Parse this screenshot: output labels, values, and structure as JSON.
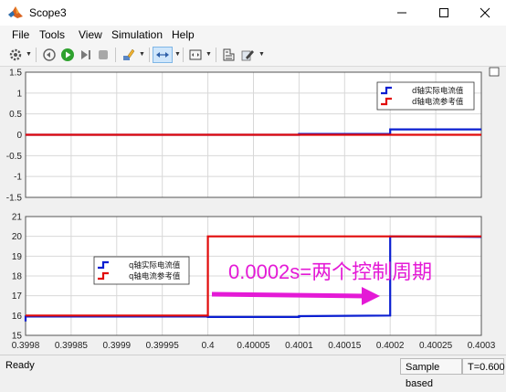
{
  "window": {
    "title": "Scope3"
  },
  "menu": {
    "items": [
      "File",
      "Tools",
      "View",
      "Simulation",
      "Help"
    ]
  },
  "toolbar": {
    "icons": [
      "settings-icon",
      "rewind-icon",
      "run-icon",
      "step-forward-icon",
      "stop-icon",
      "highlight-icon",
      "zoom-icon",
      "fit-axes-icon",
      "cursor-measure-icon",
      "style-icon"
    ]
  },
  "top_plot": {
    "legend": [
      "d轴实际电流值",
      "d轴电流参考值"
    ]
  },
  "bottom_plot": {
    "legend": [
      "q轴实际电流值",
      "q轴电流参考值"
    ],
    "annotation": "0.0002s=两个控制周期"
  },
  "status": {
    "left": "Ready",
    "mode": "Sample based",
    "time": "T=0.600"
  },
  "colors": {
    "actual": "#0b1fd1",
    "reference": "#e10b0b",
    "annotation": "#e41ad6"
  },
  "chart_data": [
    {
      "type": "line",
      "xlim": [
        0.3998,
        0.4003
      ],
      "ylim": [
        -1.5,
        1.5
      ],
      "x_ticks": [
        "0.3998",
        "0.39985",
        "0.3999",
        "0.39995",
        "0.4",
        "0.40005",
        "0.4001",
        "0.40015",
        "0.4002",
        "0.40025",
        "0.4003"
      ],
      "y_ticks": [
        "-1.5",
        "-1",
        "-0.5",
        "0",
        "0.5",
        "1",
        "1.5"
      ],
      "grid": true,
      "legend_position": "top-right",
      "series": [
        {
          "name": "d轴实际电流值",
          "x": [
            0.3998,
            0.4001,
            0.4001,
            0.4002,
            0.4002,
            0.4003
          ],
          "y": [
            0,
            0,
            0.02,
            0.02,
            0.13,
            0.13
          ]
        },
        {
          "name": "d轴电流参考值",
          "x": [
            0.3998,
            0.4003
          ],
          "y": [
            0,
            0
          ]
        }
      ]
    },
    {
      "type": "line",
      "xlim": [
        0.3998,
        0.4003
      ],
      "ylim": [
        15,
        21
      ],
      "x_ticks": [
        "0.3998",
        "0.39985",
        "0.3999",
        "0.39995",
        "0.4",
        "0.40005",
        "0.4001",
        "0.40015",
        "0.4002",
        "0.40025",
        "0.4003"
      ],
      "y_ticks": [
        "15",
        "16",
        "17",
        "18",
        "19",
        "20",
        "21"
      ],
      "grid": true,
      "legend_position": "middle-left",
      "series": [
        {
          "name": "q轴实际电流值",
          "x": [
            0.3998,
            0.3998,
            0.3999,
            0.4,
            0.4,
            0.4001,
            0.4001,
            0.4002,
            0.4002,
            0.4003
          ],
          "y": [
            15.7,
            15.95,
            15.95,
            15.95,
            15.93,
            15.93,
            15.97,
            16.0,
            20.0,
            19.97
          ]
        },
        {
          "name": "q轴电流参考值",
          "x": [
            0.3998,
            0.4,
            0.4,
            0.4003
          ],
          "y": [
            16.0,
            16.0,
            20.0,
            20.0
          ]
        }
      ]
    }
  ]
}
